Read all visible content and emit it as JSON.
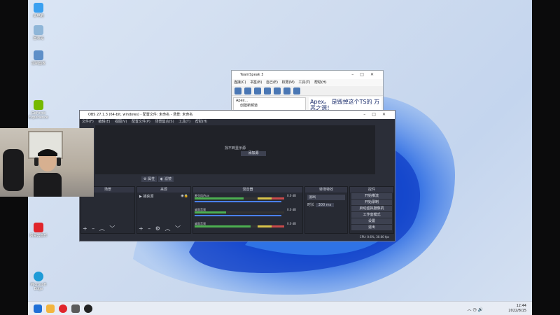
{
  "desktop": {
    "icons": [
      {
        "label": "此电脑",
        "color": "#3aa0f0"
      },
      {
        "label": "回收站",
        "color": "#8fb6d8"
      },
      {
        "label": "控制面板",
        "color": "#5e8fc8"
      },
      {
        "label": "GeForce Experience",
        "color": "#76b900"
      },
      {
        "label": "网易云音乐",
        "color": "#e0252b"
      },
      {
        "label": "Microsoft Edge",
        "color": "#1e9bd7"
      }
    ]
  },
  "teamspeak": {
    "title": "TeamSpeak 3",
    "menu": [
      "连接(C)",
      "书签(B)",
      "自己(E)",
      "权限(M)",
      "工具(T)",
      "帮助(H)"
    ],
    "tree": [
      "Apex...",
      "创建新频道"
    ],
    "chat": "Apex。 是毁掉这个TS的 万恶之源！"
  },
  "obs": {
    "title": "OBS 27.1.3 (64-bit, windows) - 配置文件: 未命名 - 场景: 未命名",
    "menu": [
      "文件(F)",
      "编辑(E)",
      "视图(V)",
      "配置文件(P)",
      "场景集合(S)",
      "工具(T)",
      "帮助(H)"
    ],
    "preview_msg": "找不到显示源",
    "preview_btn": "添加源",
    "src_props": "属性",
    "src_filter": "滤镜",
    "scenes_head": "场景",
    "sources_head": "来源",
    "source_item": "捕获源",
    "mixer_head": "混音器",
    "tracks": [
      {
        "name": "麦克风/Aux",
        "db": "0.0 dB",
        "level": 0.55
      },
      {
        "name": "桌面音频",
        "db": "0.0 dB",
        "level": 0.35
      },
      {
        "name": "桌面音频",
        "db": "0.0 dB",
        "level": 0.6
      }
    ],
    "transition_head": "转场特效",
    "transition_value": "淡出",
    "duration_label": "时长",
    "duration_value": "300 ms",
    "controls_head": "控件",
    "controls": [
      "开始推流",
      "开始录制",
      "启动虚拟摄像机",
      "工作室模式",
      "设置",
      "退出"
    ],
    "status": "CPU: 0.6%, 30.00 fps"
  },
  "taskbar": {
    "time": "12:44",
    "date": "2022/8/15",
    "apps": [
      "#1f6fd6",
      "#f3b53e",
      "#e0252b",
      "#5a5a5a",
      "#222"
    ]
  }
}
